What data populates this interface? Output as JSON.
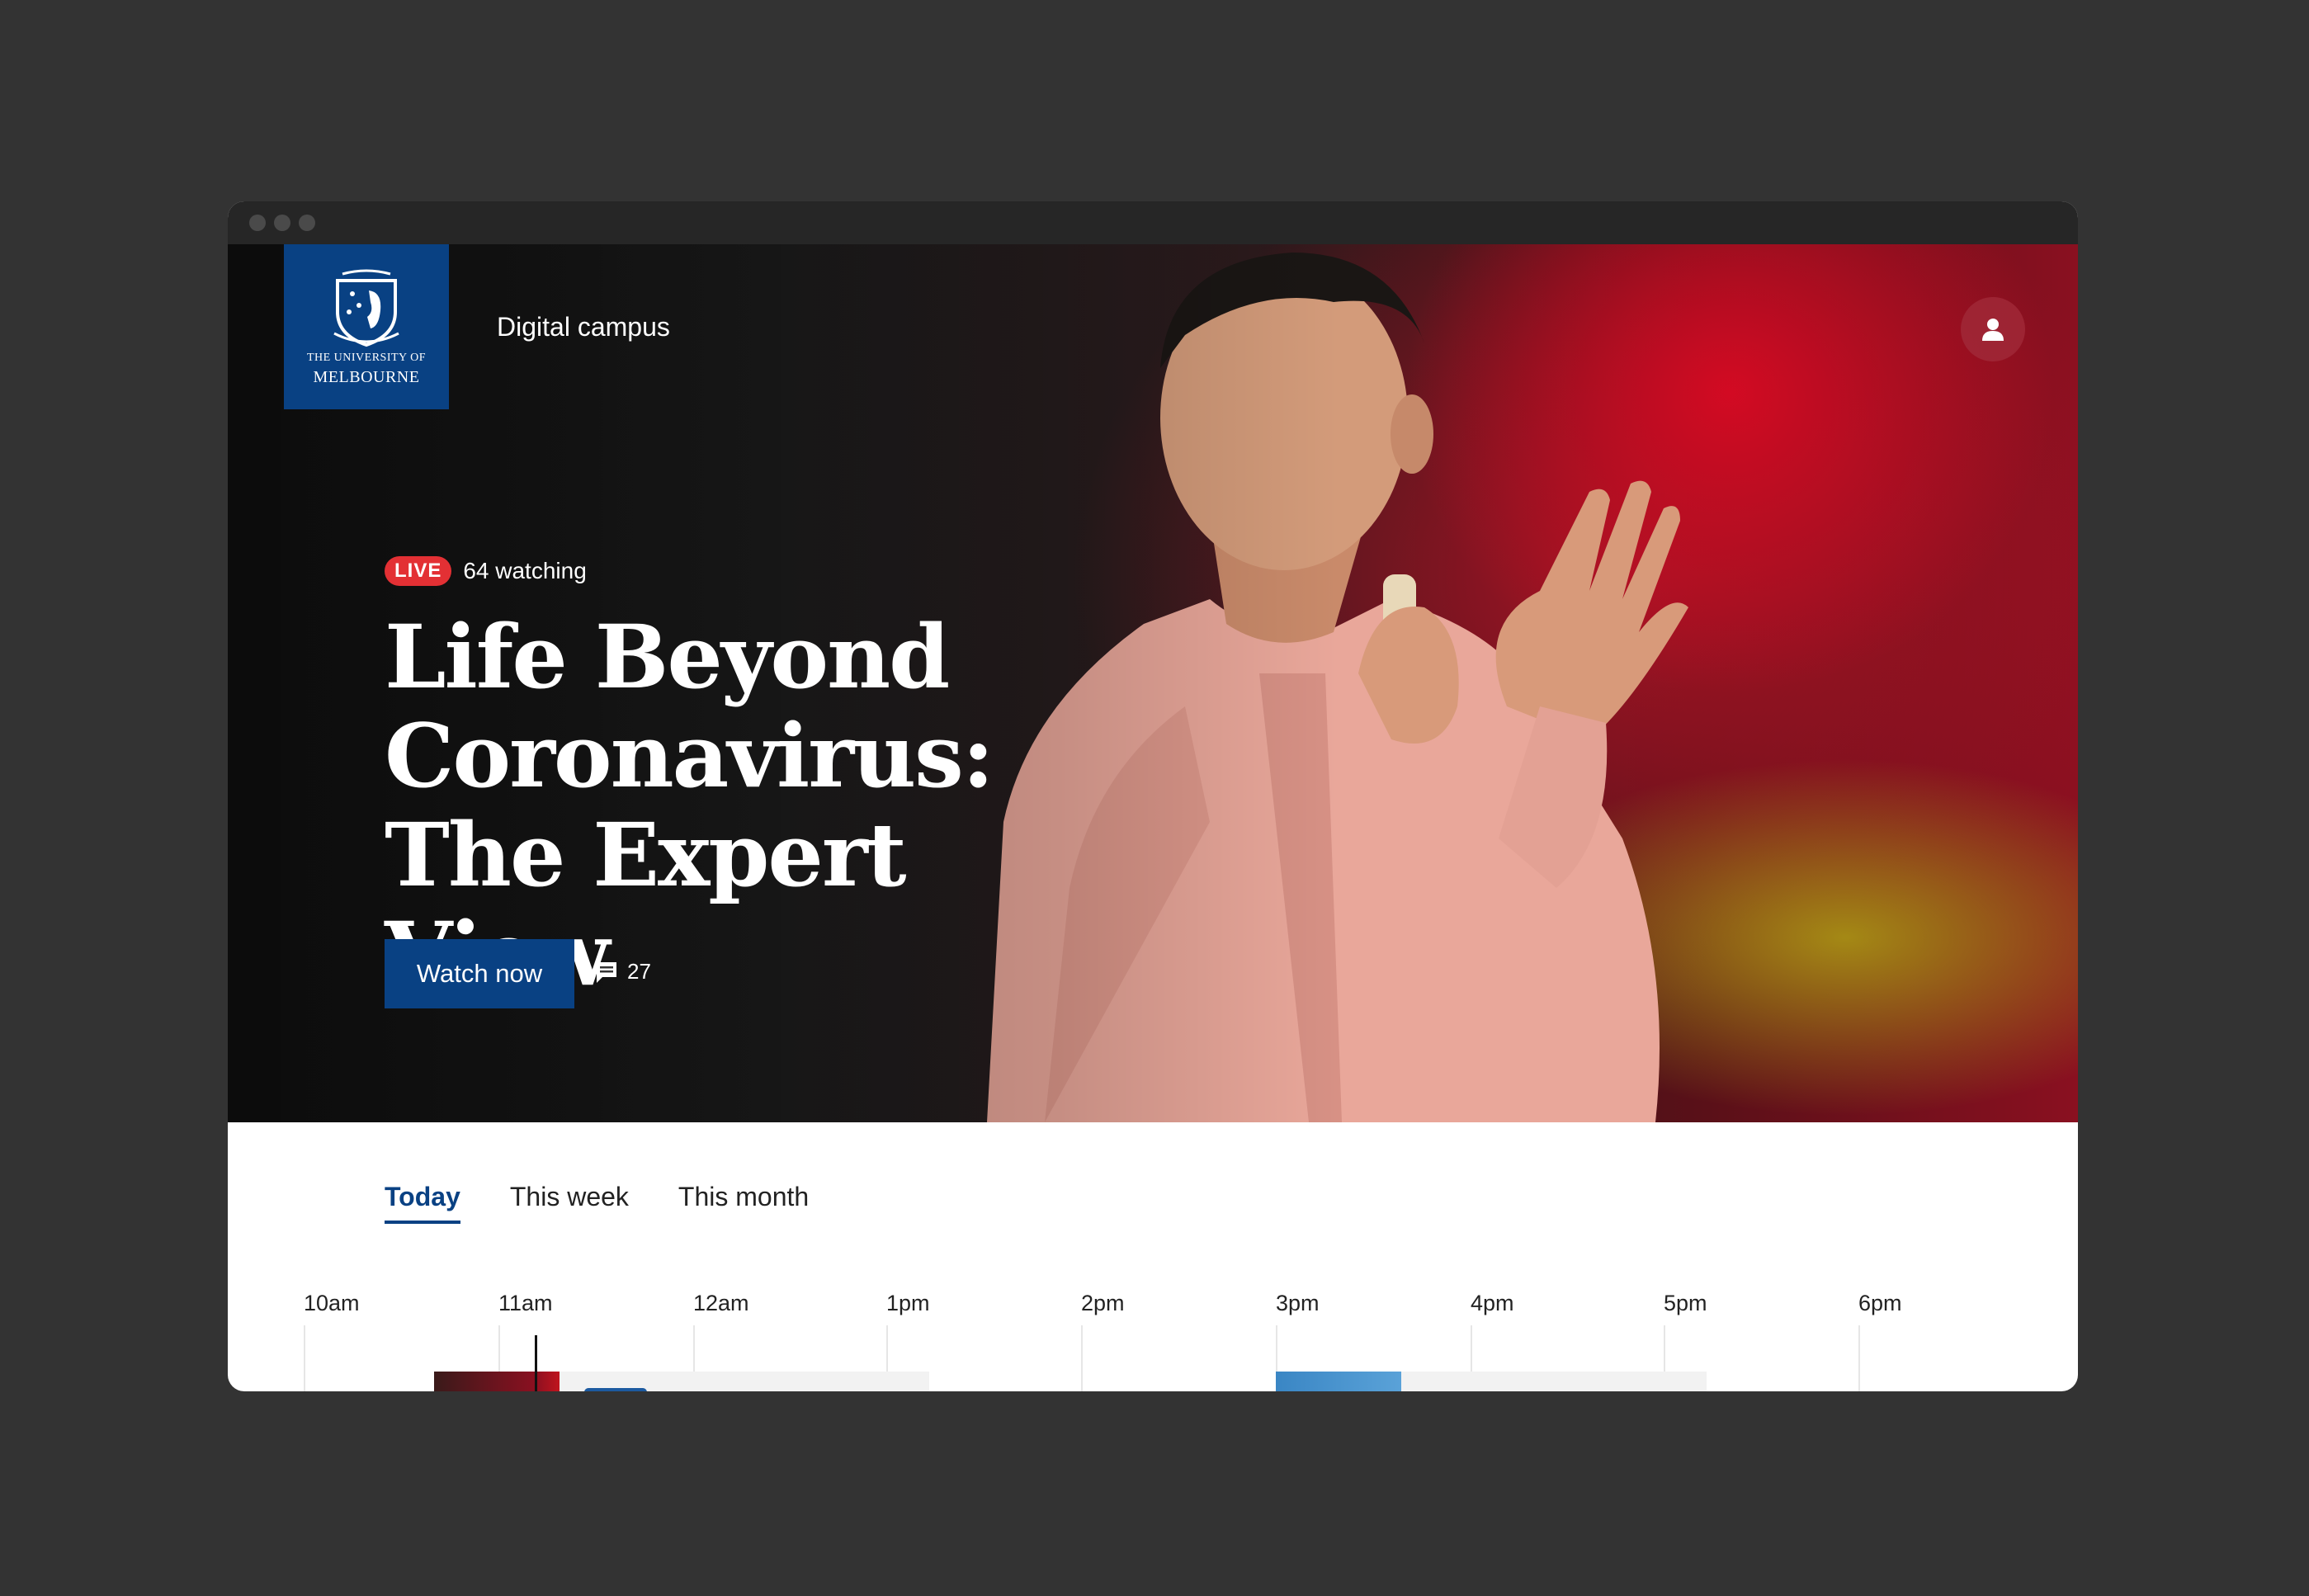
{
  "brand": {
    "logo_line1": "THE UNIVERSITY OF",
    "logo_line2": "MELBOURNE",
    "site_name": "Digital campus"
  },
  "header": {
    "profile_icon": "person-icon"
  },
  "hero": {
    "live_label": "LIVE",
    "watching": "64 watching",
    "title_line1": "Life Beyond",
    "title_line2": "Coronavirus:",
    "title_line3": "The Expert View",
    "watch_label": "Watch now",
    "comment_icon": "comment-icon",
    "comment_count": "27"
  },
  "tabs": [
    {
      "label": "Today",
      "active": true
    },
    {
      "label": "This week",
      "active": false
    },
    {
      "label": "This month",
      "active": false
    }
  ],
  "timeline": {
    "hours": [
      "10am",
      "11am",
      "12am",
      "1pm",
      "2pm",
      "3pm",
      "4pm",
      "5pm",
      "6pm"
    ]
  },
  "colors": {
    "brand_blue": "#094183",
    "live_red": "#e33034",
    "background": "#333333"
  }
}
